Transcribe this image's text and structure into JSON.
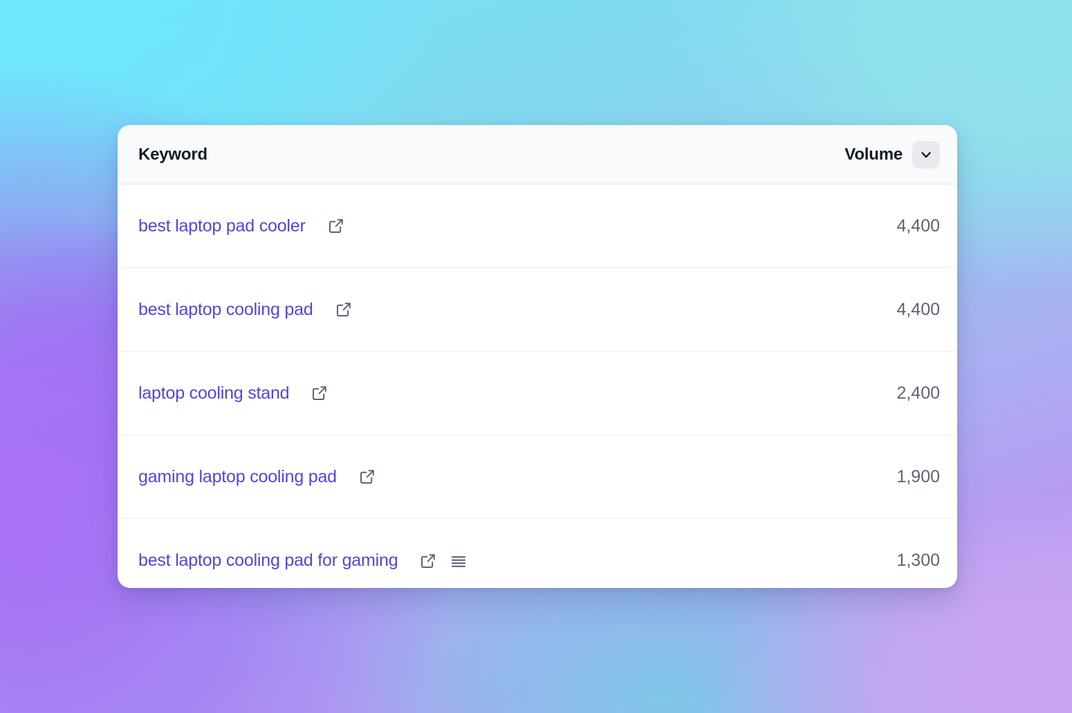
{
  "background": {
    "colors": [
      "#74e3f7",
      "#8fe2ec",
      "#a872f5",
      "#8b74f0",
      "#c9a6f2",
      "#7fc6e8"
    ]
  },
  "card": {
    "accent_link_color": "#5244e3",
    "header": {
      "keyword_label": "Keyword",
      "volume_label": "Volume",
      "sort_icon": "chevron-down-icon"
    },
    "columns": [
      "Keyword",
      "Volume"
    ],
    "rows": [
      {
        "keyword": "best laptop pad cooler",
        "volume": "4,400",
        "icons": [
          "external-link-icon"
        ]
      },
      {
        "keyword": "best laptop cooling pad",
        "volume": "4,400",
        "icons": [
          "external-link-icon"
        ]
      },
      {
        "keyword": "laptop cooling stand",
        "volume": "2,400",
        "icons": [
          "external-link-icon"
        ]
      },
      {
        "keyword": "gaming laptop cooling pad",
        "volume": "1,900",
        "icons": [
          "external-link-icon"
        ]
      },
      {
        "keyword": "best laptop cooling pad for gaming",
        "volume": "1,300",
        "icons": [
          "external-link-icon",
          "menu-lines-icon"
        ]
      }
    ]
  }
}
